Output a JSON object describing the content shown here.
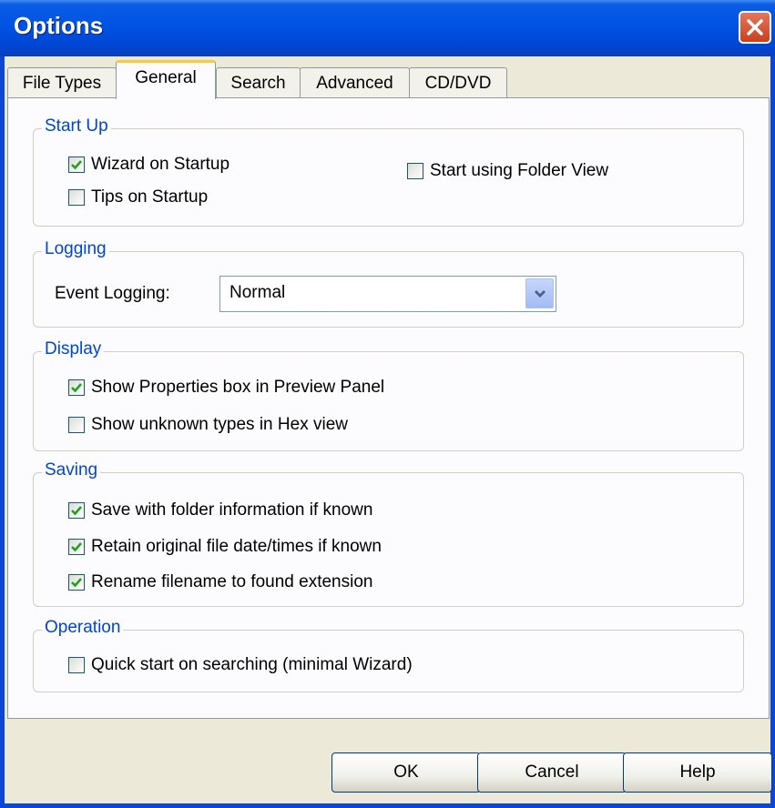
{
  "window": {
    "title": "Options"
  },
  "tabs": [
    {
      "label": "File Types"
    },
    {
      "label": "General"
    },
    {
      "label": "Search"
    },
    {
      "label": "Advanced"
    },
    {
      "label": "CD/DVD"
    }
  ],
  "active_tab": "General",
  "startup": {
    "legend": "Start Up",
    "wizard_on_startup": {
      "label": "Wizard on Startup",
      "checked": true
    },
    "tips_on_startup": {
      "label": "Tips on Startup",
      "checked": false
    },
    "start_folder_view": {
      "label": "Start using Folder View",
      "checked": false
    }
  },
  "logging": {
    "legend": "Logging",
    "event_logging_label": "Event Logging:",
    "event_logging_value": "Normal"
  },
  "display": {
    "legend": "Display",
    "show_properties": {
      "label": "Show Properties box in Preview Panel",
      "checked": true
    },
    "show_hex": {
      "label": "Show unknown types in Hex view",
      "checked": false
    }
  },
  "saving": {
    "legend": "Saving",
    "save_folder_info": {
      "label": "Save with folder information if known",
      "checked": true
    },
    "retain_dates": {
      "label": "Retain original file date/times if known",
      "checked": true
    },
    "rename_extension": {
      "label": "Rename filename to found extension",
      "checked": true
    }
  },
  "operation": {
    "legend": "Operation",
    "quick_start": {
      "label": "Quick start on searching (minimal Wizard)",
      "checked": false
    }
  },
  "buttons": {
    "ok": "OK",
    "cancel": "Cancel",
    "help": "Help"
  }
}
